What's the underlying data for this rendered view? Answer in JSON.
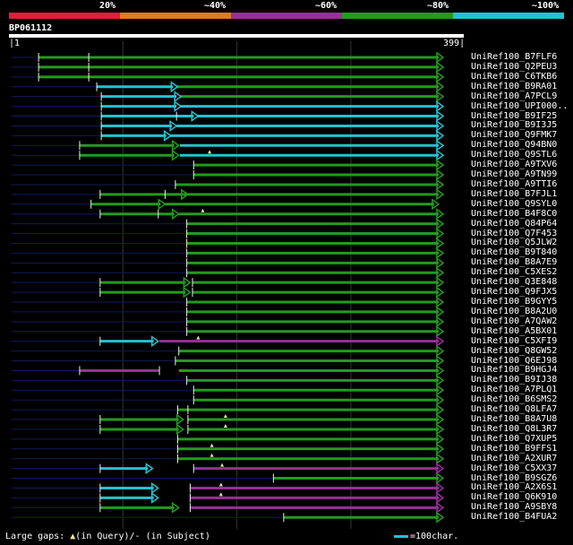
{
  "legend": {
    "labels": [
      "20%",
      "~40%",
      "~60%",
      "~80%",
      "~100%"
    ],
    "colors": [
      "#e01e3c",
      "#e07b1e",
      "#9b2d9b",
      "#239b1e",
      "#22c3d1"
    ]
  },
  "query": {
    "name": "BP061112",
    "start": "1",
    "end": "399",
    "length": 399
  },
  "colors": {
    "green": "#239b1e",
    "cyan": "#22c3d1",
    "purple": "#9b2d9b",
    "navy": "#101a5a",
    "marker": "#e8e890"
  },
  "hits": [
    {
      "name": "UniRef100_B7FLF6",
      "segs": [
        [
          2,
          26,
          "navy"
        ],
        [
          26,
          377,
          "green"
        ]
      ],
      "ticks": [
        26,
        70
      ],
      "arrow": [
        377,
        "green"
      ]
    },
    {
      "name": "UniRef100_Q2PEU3",
      "segs": [
        [
          2,
          26,
          "navy"
        ],
        [
          26,
          377,
          "green"
        ]
      ],
      "ticks": [
        26,
        70
      ],
      "arrow": [
        377,
        "green"
      ]
    },
    {
      "name": "UniRef100_C6TKB6",
      "segs": [
        [
          2,
          26,
          "navy"
        ],
        [
          26,
          377,
          "green"
        ]
      ],
      "ticks": [
        26,
        70
      ],
      "arrow": [
        377,
        "green"
      ]
    },
    {
      "name": "UniRef100_B9RA01",
      "segs": [
        [
          2,
          77,
          "navy"
        ],
        [
          77,
          144,
          "cyan"
        ],
        [
          147,
          377,
          "green"
        ]
      ],
      "ticks": [
        77
      ],
      "arrow": [
        377,
        "green"
      ],
      "midarrows": [
        [
          144,
          "cyan"
        ]
      ]
    },
    {
      "name": "UniRef100_A7PCL9",
      "segs": [
        [
          2,
          81,
          "navy"
        ],
        [
          81,
          147,
          "cyan"
        ],
        [
          150,
          377,
          "green"
        ]
      ],
      "ticks": [
        81
      ],
      "arrow": [
        377,
        "green"
      ],
      "midarrows": [
        [
          147,
          "cyan"
        ]
      ]
    },
    {
      "name": "UniRef100_UPI000..",
      "segs": [
        [
          2,
          81,
          "navy"
        ],
        [
          81,
          147,
          "cyan"
        ],
        [
          150,
          377,
          "cyan"
        ]
      ],
      "ticks": [
        81
      ],
      "arrow": [
        377,
        "cyan"
      ],
      "midarrows": [
        [
          147,
          "cyan"
        ]
      ]
    },
    {
      "name": "UniRef100_B9IF25",
      "segs": [
        [
          2,
          81,
          "navy"
        ],
        [
          81,
          147,
          "cyan"
        ],
        [
          147,
          162,
          "cyan"
        ],
        [
          165,
          377,
          "cyan"
        ]
      ],
      "ticks": [
        81,
        147
      ],
      "arrow": [
        377,
        "cyan"
      ],
      "midarrows": [
        [
          162,
          "cyan"
        ]
      ]
    },
    {
      "name": "UniRef100_B9I3J5",
      "segs": [
        [
          2,
          81,
          "navy"
        ],
        [
          81,
          143,
          "cyan"
        ],
        [
          147,
          377,
          "cyan"
        ]
      ],
      "ticks": [
        81
      ],
      "arrow": [
        377,
        "cyan"
      ],
      "midarrows": [
        [
          143,
          "cyan"
        ]
      ]
    },
    {
      "name": "UniRef100_Q9FMK7",
      "segs": [
        [
          2,
          81,
          "navy"
        ],
        [
          81,
          138,
          "cyan"
        ],
        [
          141,
          377,
          "cyan"
        ]
      ],
      "ticks": [
        81
      ],
      "arrow": [
        377,
        "cyan"
      ],
      "midarrows": [
        [
          138,
          "cyan"
        ]
      ]
    },
    {
      "name": "UniRef100_Q94BN0",
      "segs": [
        [
          2,
          62,
          "navy"
        ],
        [
          62,
          145,
          "green"
        ],
        [
          150,
          377,
          "cyan"
        ]
      ],
      "ticks": [
        62
      ],
      "arrow": [
        377,
        "cyan"
      ],
      "midarrows": [
        [
          145,
          "green"
        ]
      ]
    },
    {
      "name": "UniRef100_Q9STL6",
      "segs": [
        [
          2,
          62,
          "navy"
        ],
        [
          62,
          145,
          "green"
        ],
        [
          150,
          377,
          "cyan"
        ]
      ],
      "ticks": [
        62
      ],
      "arrow": [
        377,
        "cyan"
      ],
      "midarrows": [
        [
          145,
          "green"
        ]
      ],
      "gaps": [
        176
      ]
    },
    {
      "name": "UniRef100_A9TXV6",
      "segs": [
        [
          2,
          162,
          "navy"
        ],
        [
          162,
          377,
          "green"
        ]
      ],
      "ticks": [
        162
      ],
      "arrow": [
        377,
        "green"
      ]
    },
    {
      "name": "UniRef100_A9TN99",
      "segs": [
        [
          2,
          162,
          "navy"
        ],
        [
          162,
          377,
          "green"
        ]
      ],
      "ticks": [
        162
      ],
      "arrow": [
        377,
        "green"
      ]
    },
    {
      "name": "UniRef100_A9TTI6",
      "segs": [
        [
          2,
          146,
          "navy"
        ],
        [
          146,
          377,
          "green"
        ]
      ],
      "ticks": [
        146
      ],
      "arrow": [
        377,
        "green"
      ]
    },
    {
      "name": "UniRef100_B7FJL1",
      "segs": [
        [
          2,
          80,
          "navy"
        ],
        [
          80,
          153,
          "green"
        ],
        [
          153,
          377,
          "green"
        ]
      ],
      "ticks": [
        80,
        137
      ],
      "arrow": [
        377,
        "green"
      ],
      "midarrows": [
        [
          153,
          "green"
        ]
      ]
    },
    {
      "name": "UniRef100_Q9SYL0",
      "segs": [
        [
          2,
          72,
          "navy"
        ],
        [
          72,
          133,
          "green"
        ],
        [
          137,
          373,
          "green"
        ]
      ],
      "ticks": [
        72
      ],
      "arrow": [
        373,
        "green"
      ],
      "midarrows": [
        [
          133,
          "green"
        ]
      ]
    },
    {
      "name": "UniRef100_B4F8C0",
      "segs": [
        [
          2,
          80,
          "navy"
        ],
        [
          80,
          145,
          "green"
        ],
        [
          149,
          377,
          "green"
        ]
      ],
      "ticks": [
        80,
        131
      ],
      "arrow": [
        377,
        "green"
      ],
      "midarrows": [
        [
          145,
          "green"
        ]
      ],
      "gaps": [
        170
      ]
    },
    {
      "name": "UniRef100_Q84P64",
      "segs": [
        [
          2,
          156,
          "navy"
        ],
        [
          156,
          377,
          "green"
        ]
      ],
      "ticks": [
        156
      ],
      "arrow": [
        377,
        "green"
      ]
    },
    {
      "name": "UniRef100_Q7F453",
      "segs": [
        [
          2,
          156,
          "navy"
        ],
        [
          156,
          377,
          "green"
        ]
      ],
      "ticks": [
        156
      ],
      "arrow": [
        377,
        "green"
      ]
    },
    {
      "name": "UniRef100_Q5JLW2",
      "segs": [
        [
          2,
          156,
          "navy"
        ],
        [
          156,
          377,
          "green"
        ]
      ],
      "ticks": [
        156
      ],
      "arrow": [
        377,
        "green"
      ]
    },
    {
      "name": "UniRef100_B9T840",
      "segs": [
        [
          2,
          156,
          "navy"
        ],
        [
          156,
          377,
          "green"
        ]
      ],
      "ticks": [
        156
      ],
      "arrow": [
        377,
        "green"
      ]
    },
    {
      "name": "UniRef100_B8A7E9",
      "segs": [
        [
          2,
          156,
          "navy"
        ],
        [
          156,
          377,
          "green"
        ]
      ],
      "ticks": [
        156
      ],
      "arrow": [
        377,
        "green"
      ]
    },
    {
      "name": "UniRef100_C5XES2",
      "segs": [
        [
          2,
          156,
          "navy"
        ],
        [
          156,
          377,
          "green"
        ]
      ],
      "ticks": [
        156
      ],
      "arrow": [
        377,
        "green"
      ]
    },
    {
      "name": "UniRef100_Q3E848",
      "segs": [
        [
          2,
          80,
          "navy"
        ],
        [
          80,
          155,
          "green"
        ],
        [
          161,
          377,
          "green"
        ]
      ],
      "ticks": [
        80,
        161
      ],
      "arrow": [
        377,
        "green"
      ],
      "midarrows": [
        [
          155,
          "green"
        ]
      ]
    },
    {
      "name": "UniRef100_Q9FJX5",
      "segs": [
        [
          2,
          80,
          "navy"
        ],
        [
          80,
          155,
          "green"
        ],
        [
          161,
          377,
          "green"
        ]
      ],
      "ticks": [
        80,
        161
      ],
      "arrow": [
        377,
        "green"
      ],
      "midarrows": [
        [
          155,
          "green"
        ]
      ]
    },
    {
      "name": "UniRef100_B9GYY5",
      "segs": [
        [
          2,
          156,
          "navy"
        ],
        [
          156,
          377,
          "green"
        ]
      ],
      "ticks": [
        156
      ],
      "arrow": [
        377,
        "green"
      ]
    },
    {
      "name": "UniRef100_B8A2U0",
      "segs": [
        [
          2,
          156,
          "navy"
        ],
        [
          156,
          377,
          "green"
        ]
      ],
      "ticks": [
        156
      ],
      "arrow": [
        377,
        "green"
      ]
    },
    {
      "name": "UniRef100_A7QAW2",
      "segs": [
        [
          2,
          156,
          "navy"
        ],
        [
          156,
          377,
          "green"
        ]
      ],
      "ticks": [
        156
      ],
      "arrow": [
        377,
        "green"
      ]
    },
    {
      "name": "UniRef100_A5BX01",
      "segs": [
        [
          2,
          156,
          "navy"
        ],
        [
          156,
          377,
          "green"
        ]
      ],
      "ticks": [
        156
      ],
      "arrow": [
        377,
        "green"
      ]
    },
    {
      "name": "UniRef100_C5XFI9",
      "segs": [
        [
          2,
          80,
          "navy"
        ],
        [
          80,
          127,
          "cyan"
        ],
        [
          132,
          377,
          "purple"
        ]
      ],
      "ticks": [
        80
      ],
      "arrow": [
        377,
        "purple"
      ],
      "midarrows": [
        [
          127,
          "cyan"
        ]
      ],
      "gaps": [
        166
      ]
    },
    {
      "name": "UniRef100_Q8GW52",
      "segs": [
        [
          2,
          149,
          "navy"
        ],
        [
          149,
          377,
          "green"
        ]
      ],
      "ticks": [
        149
      ],
      "arrow": [
        377,
        "green"
      ]
    },
    {
      "name": "UniRef100_Q6EJ98",
      "segs": [
        [
          2,
          146,
          "navy"
        ],
        [
          146,
          377,
          "green"
        ]
      ],
      "ticks": [
        146
      ],
      "arrow": [
        377,
        "green"
      ]
    },
    {
      "name": "UniRef100_B9HGJ4",
      "segs": [
        [
          2,
          62,
          "navy"
        ],
        [
          62,
          132,
          "purple"
        ],
        [
          149,
          377,
          "green"
        ]
      ],
      "ticks": [
        62,
        132
      ],
      "arrow": [
        377,
        "green"
      ]
    },
    {
      "name": "UniRef100_B9IJ38",
      "segs": [
        [
          2,
          156,
          "navy"
        ],
        [
          156,
          377,
          "green"
        ]
      ],
      "ticks": [
        156
      ],
      "arrow": [
        377,
        "green"
      ]
    },
    {
      "name": "UniRef100_A7PLQ1",
      "segs": [
        [
          2,
          162,
          "navy"
        ],
        [
          162,
          377,
          "green"
        ]
      ],
      "ticks": [
        162
      ],
      "arrow": [
        377,
        "green"
      ]
    },
    {
      "name": "UniRef100_B6SMS2",
      "segs": [
        [
          2,
          162,
          "navy"
        ],
        [
          162,
          377,
          "green"
        ]
      ],
      "ticks": [
        162
      ],
      "arrow": [
        377,
        "green"
      ]
    },
    {
      "name": "UniRef100_Q8LFA7",
      "segs": [
        [
          2,
          148,
          "navy"
        ],
        [
          148,
          377,
          "green"
        ]
      ],
      "ticks": [
        148,
        157
      ],
      "arrow": [
        377,
        "green"
      ]
    },
    {
      "name": "UniRef100_B8A7U8",
      "segs": [
        [
          2,
          80,
          "navy"
        ],
        [
          80,
          149,
          "green"
        ],
        [
          157,
          377,
          "green"
        ]
      ],
      "ticks": [
        80,
        157
      ],
      "arrow": [
        377,
        "green"
      ],
      "midarrows": [
        [
          149,
          "green"
        ]
      ],
      "gaps": [
        190
      ]
    },
    {
      "name": "UniRef100_Q8L3R7",
      "segs": [
        [
          2,
          80,
          "navy"
        ],
        [
          80,
          149,
          "green"
        ],
        [
          157,
          377,
          "green"
        ]
      ],
      "ticks": [
        80,
        157
      ],
      "arrow": [
        377,
        "green"
      ],
      "midarrows": [
        [
          149,
          "green"
        ]
      ],
      "gaps": [
        190
      ]
    },
    {
      "name": "UniRef100_Q7XUP5",
      "segs": [
        [
          2,
          148,
          "navy"
        ],
        [
          148,
          377,
          "green"
        ]
      ],
      "ticks": [
        148
      ],
      "arrow": [
        377,
        "green"
      ]
    },
    {
      "name": "UniRef100_B9FFS1",
      "segs": [
        [
          2,
          148,
          "navy"
        ],
        [
          148,
          377,
          "green"
        ]
      ],
      "ticks": [
        148
      ],
      "arrow": [
        377,
        "green"
      ],
      "gaps": [
        178
      ]
    },
    {
      "name": "UniRef100_A2XUR7",
      "segs": [
        [
          2,
          148,
          "navy"
        ],
        [
          148,
          377,
          "green"
        ]
      ],
      "ticks": [
        148
      ],
      "arrow": [
        377,
        "green"
      ],
      "gaps": [
        178
      ]
    },
    {
      "name": "UniRef100_C5XX37",
      "segs": [
        [
          2,
          80,
          "navy"
        ],
        [
          80,
          122,
          "cyan"
        ],
        [
          162,
          377,
          "purple"
        ]
      ],
      "ticks": [
        80,
        162
      ],
      "arrow": [
        377,
        "purple"
      ],
      "midarrows": [
        [
          122,
          "cyan"
        ]
      ],
      "gaps": [
        187
      ]
    },
    {
      "name": "UniRef100_B9SGZ6",
      "segs": [
        [
          2,
          232,
          "navy"
        ],
        [
          232,
          377,
          "green"
        ]
      ],
      "ticks": [
        232
      ],
      "arrow": [
        377,
        "green"
      ]
    },
    {
      "name": "UniRef100_A2X6S1",
      "segs": [
        [
          2,
          80,
          "navy"
        ],
        [
          80,
          127,
          "cyan"
        ],
        [
          159,
          377,
          "purple"
        ]
      ],
      "ticks": [
        80,
        159
      ],
      "arrow": [
        377,
        "purple"
      ],
      "midarrows": [
        [
          127,
          "cyan"
        ]
      ],
      "gaps": [
        186
      ]
    },
    {
      "name": "UniRef100_Q6K910",
      "segs": [
        [
          2,
          80,
          "navy"
        ],
        [
          80,
          127,
          "cyan"
        ],
        [
          159,
          377,
          "purple"
        ]
      ],
      "ticks": [
        80,
        159
      ],
      "arrow": [
        377,
        "purple"
      ],
      "midarrows": [
        [
          127,
          "cyan"
        ]
      ],
      "gaps": [
        186
      ]
    },
    {
      "name": "UniRef100_A9SBY8",
      "segs": [
        [
          2,
          80,
          "navy"
        ],
        [
          80,
          145,
          "green"
        ],
        [
          159,
          377,
          "purple"
        ]
      ],
      "ticks": [
        80,
        159
      ],
      "arrow": [
        377,
        "purple"
      ],
      "midarrows": [
        [
          145,
          "green"
        ]
      ]
    },
    {
      "name": "UniRef100_B4FUA2",
      "segs": [
        [
          2,
          241,
          "navy"
        ],
        [
          241,
          377,
          "green"
        ]
      ],
      "ticks": [
        241
      ],
      "arrow": [
        377,
        "green"
      ]
    }
  ],
  "footer": {
    "gaps_label": "Large gaps:",
    "query_gap": "(in Query)/",
    "subject_gap": "(in Subject)",
    "scale_label": "=100char."
  }
}
